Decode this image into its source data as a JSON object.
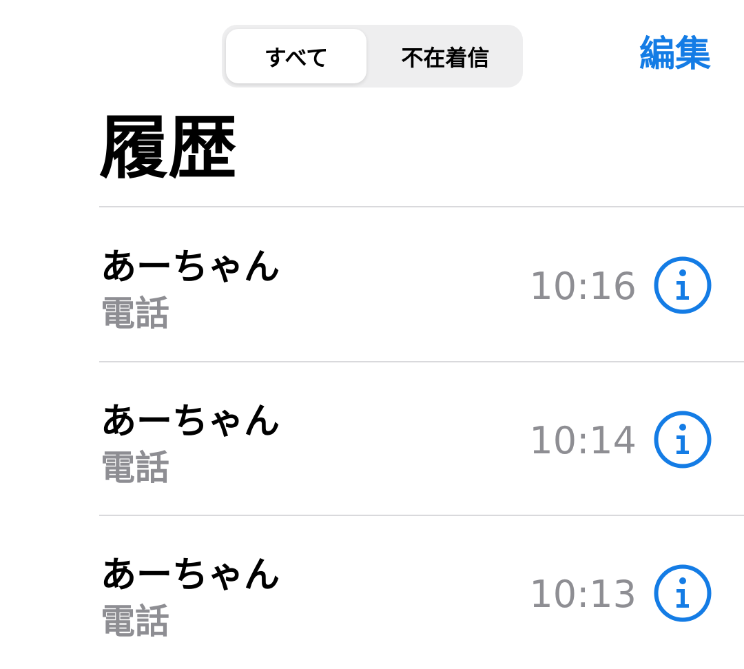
{
  "header": {
    "segments": [
      "すべて",
      "不在着信"
    ],
    "selected_segment": "すべて",
    "edit_label": "編集",
    "title": "履歴"
  },
  "calls": [
    {
      "name": "あーちゃん",
      "type": "電話",
      "time": "10:16"
    },
    {
      "name": "あーちゃん",
      "type": "電話",
      "time": "10:14"
    },
    {
      "name": "あーちゃん",
      "type": "電話",
      "time": "10:13"
    }
  ],
  "colors": {
    "accent": "#147ce5",
    "secondary_text": "#8e8e93",
    "separator": "#d9d9dc",
    "segment_background": "#eeeeef"
  },
  "icons": {
    "info": "info-circle-icon"
  }
}
